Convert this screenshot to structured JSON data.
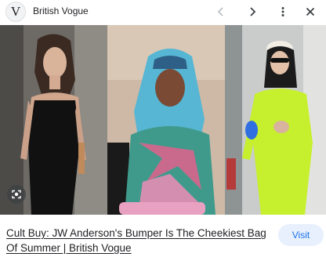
{
  "header": {
    "logo_letter": "V",
    "source_name": "British Vogue",
    "prev_icon": "chevron-left-icon",
    "next_icon": "chevron-right-icon",
    "more_icon": "more-vert-icon",
    "close_icon": "close-icon"
  },
  "result": {
    "title": "Cult Buy: JW Anderson's Bumper Is The Cheekiest Bag Of Summer | British Vogue",
    "visit_label": "Visit",
    "lens_icon": "lens-search-icon"
  },
  "colors": {
    "accent": "#1a73e8",
    "visit_bg": "#e8f0fe",
    "text": "#202124"
  }
}
